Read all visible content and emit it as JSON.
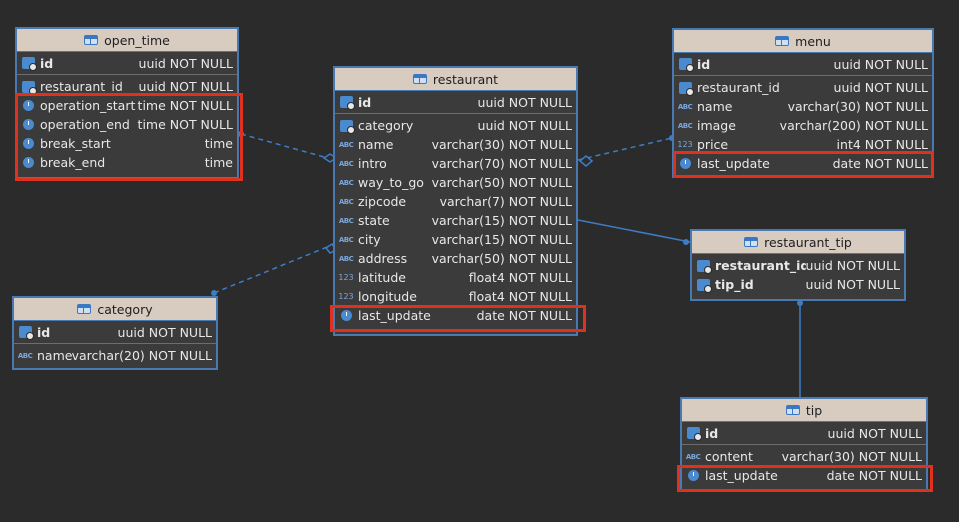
{
  "tables": {
    "open_time": {
      "title": "open_time",
      "pk": {
        "name": "id",
        "type": "uuid NOT NULL"
      },
      "columns": [
        {
          "name": "restaurant_id",
          "type": "uuid NOT NULL",
          "icon": "key-icon"
        },
        {
          "name": "operation_start",
          "type": "time NOT NULL",
          "icon": "clock-icon"
        },
        {
          "name": "operation_end",
          "type": "time NOT NULL",
          "icon": "clock-icon"
        },
        {
          "name": "break_start",
          "type": "time",
          "icon": "clock-icon"
        },
        {
          "name": "break_end",
          "type": "time",
          "icon": "clock-icon"
        }
      ]
    },
    "restaurant": {
      "title": "restaurant",
      "pk": {
        "name": "id",
        "type": "uuid NOT NULL"
      },
      "columns": [
        {
          "name": "category",
          "type": "uuid NOT NULL",
          "icon": "key-icon"
        },
        {
          "name": "name",
          "type": "varchar(30) NOT NULL",
          "icon": "abc-icon"
        },
        {
          "name": "intro",
          "type": "varchar(70) NOT NULL",
          "icon": "abc-icon"
        },
        {
          "name": "way_to_go",
          "type": "varchar(50) NOT NULL",
          "icon": "abc-icon"
        },
        {
          "name": "zipcode",
          "type": "varchar(7) NOT NULL",
          "icon": "abc-icon"
        },
        {
          "name": "state",
          "type": "varchar(15) NOT NULL",
          "icon": "abc-icon"
        },
        {
          "name": "city",
          "type": "varchar(15) NOT NULL",
          "icon": "abc-icon"
        },
        {
          "name": "address",
          "type": "varchar(50) NOT NULL",
          "icon": "abc-icon"
        },
        {
          "name": "latitude",
          "type": "float4 NOT NULL",
          "icon": "num-icon"
        },
        {
          "name": "longitude",
          "type": "float4 NOT NULL",
          "icon": "num-icon"
        },
        {
          "name": "last_update",
          "type": "date NOT NULL",
          "icon": "clock-icon"
        }
      ]
    },
    "menu": {
      "title": "menu",
      "pk": {
        "name": "id",
        "type": "uuid NOT NULL"
      },
      "columns": [
        {
          "name": "restaurant_id",
          "type": "uuid NOT NULL",
          "icon": "key-icon"
        },
        {
          "name": "name",
          "type": "varchar(30) NOT NULL",
          "icon": "abc-icon"
        },
        {
          "name": "image",
          "type": "varchar(200) NOT NULL",
          "icon": "abc-icon"
        },
        {
          "name": "price",
          "type": "int4 NOT NULL",
          "icon": "num-icon"
        },
        {
          "name": "last_update",
          "type": "date NOT NULL",
          "icon": "clock-icon"
        }
      ]
    },
    "category": {
      "title": "category",
      "pk": {
        "name": "id",
        "type": "uuid NOT NULL"
      },
      "columns": [
        {
          "name": "name",
          "type": "varchar(20) NOT NULL",
          "icon": "abc-icon"
        }
      ]
    },
    "restaurant_tip": {
      "title": "restaurant_tip",
      "pk": null,
      "columns": [
        {
          "name": "restaurant_id",
          "type": "uuid NOT NULL",
          "icon": "key-icon",
          "bold": true
        },
        {
          "name": "tip_id",
          "type": "uuid NOT NULL",
          "icon": "key-icon",
          "bold": true
        }
      ]
    },
    "tip": {
      "title": "tip",
      "pk": {
        "name": "id",
        "type": "uuid NOT NULL"
      },
      "columns": [
        {
          "name": "content",
          "type": "varchar(30) NOT NULL",
          "icon": "abc-icon"
        },
        {
          "name": "last_update",
          "type": "date NOT NULL",
          "icon": "clock-icon"
        }
      ]
    }
  },
  "colors": {
    "background": "#2b2b2b",
    "header": "#d8ccc1",
    "border": "#4a78b0",
    "highlight": "#e0301e",
    "connector": "#3e7cc4"
  }
}
